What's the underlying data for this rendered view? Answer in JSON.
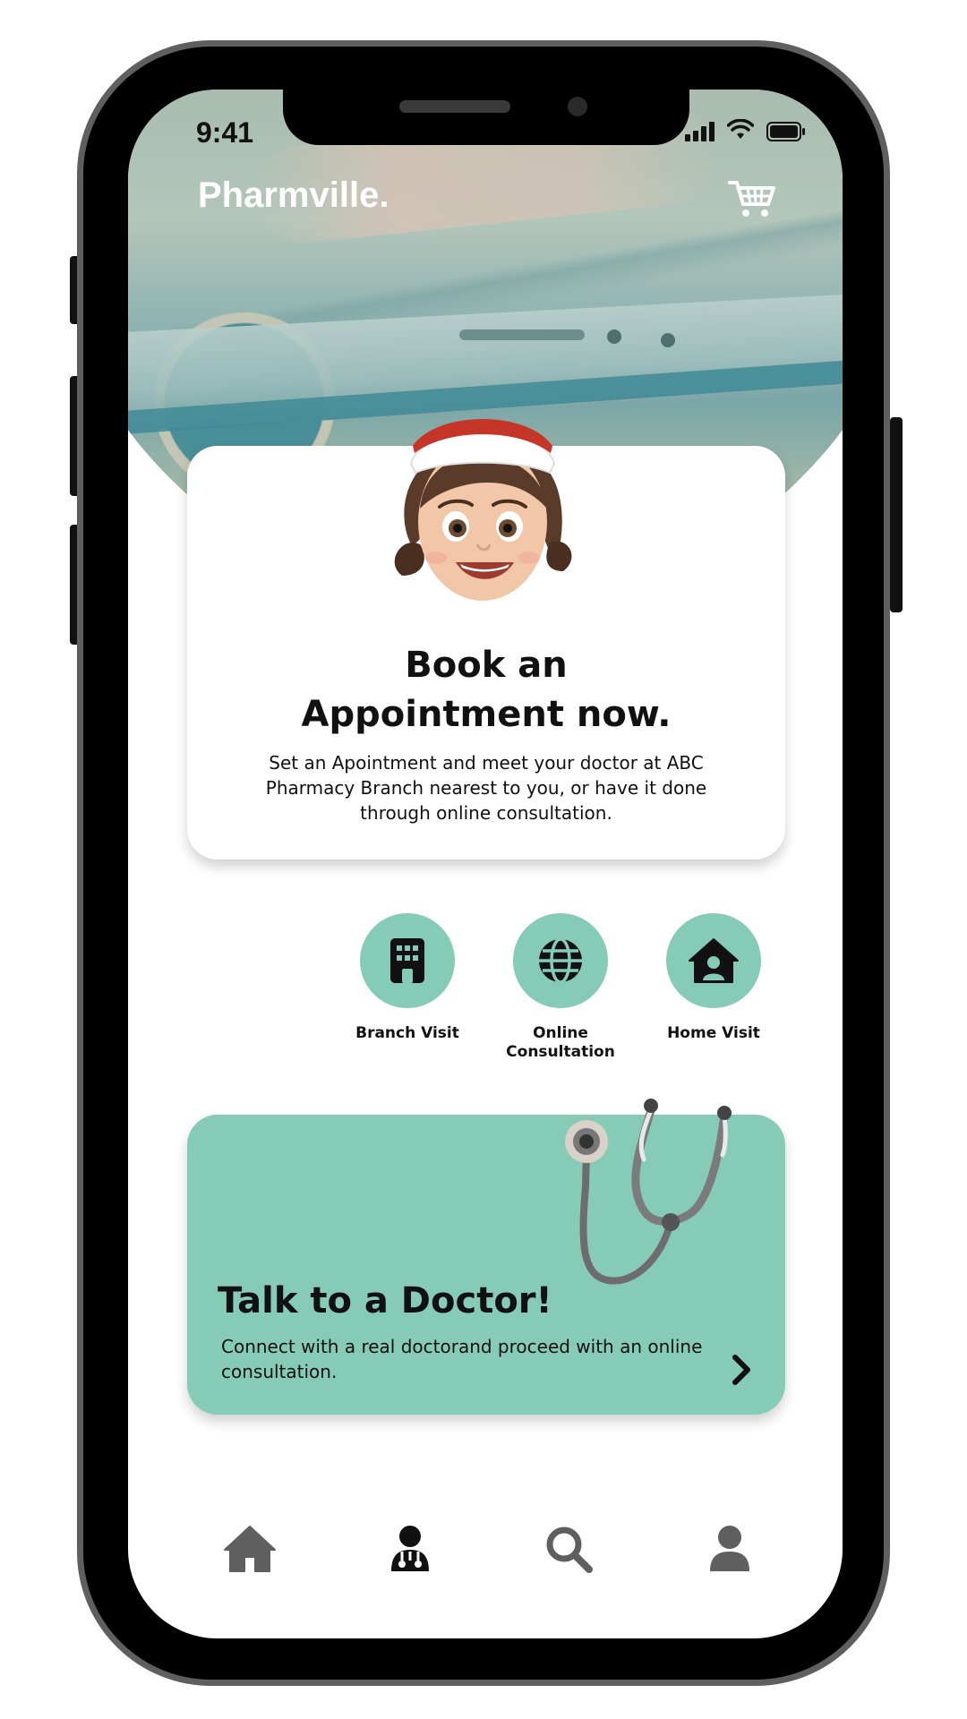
{
  "status_bar": {
    "time": "9:41"
  },
  "header": {
    "brand": "Pharmville.",
    "cart_icon": "cart-icon"
  },
  "appointment_card": {
    "title": "Book an\nAppointment now.",
    "description": "Set an Apointment and meet your doctor at ABC Pharmacy Branch nearest to you, or have it done through online consultation.",
    "avatar_icon": "nurse-avatar"
  },
  "visit_options": [
    {
      "label": "Branch Visit",
      "icon": "building-icon"
    },
    {
      "label": "Online\nConsultation",
      "icon": "globe-icon"
    },
    {
      "label": "Home Visit",
      "icon": "home-user-icon"
    }
  ],
  "doctor_card": {
    "title": "Talk to a Doctor!",
    "description": "Connect with a real doctorand proceed with an online consultation.",
    "icon": "stethoscope-icon",
    "action_icon": "chevron-right-icon"
  },
  "bottom_nav": [
    {
      "name": "home",
      "icon": "home-icon"
    },
    {
      "name": "doctor",
      "icon": "doctor-icon",
      "active": true
    },
    {
      "name": "search",
      "icon": "search-icon"
    },
    {
      "name": "profile",
      "icon": "user-icon"
    }
  ],
  "colors": {
    "accent": "#86cbb5",
    "text": "#111111",
    "nav_inactive": "#5f5f5f",
    "nav_active": "#111111"
  }
}
